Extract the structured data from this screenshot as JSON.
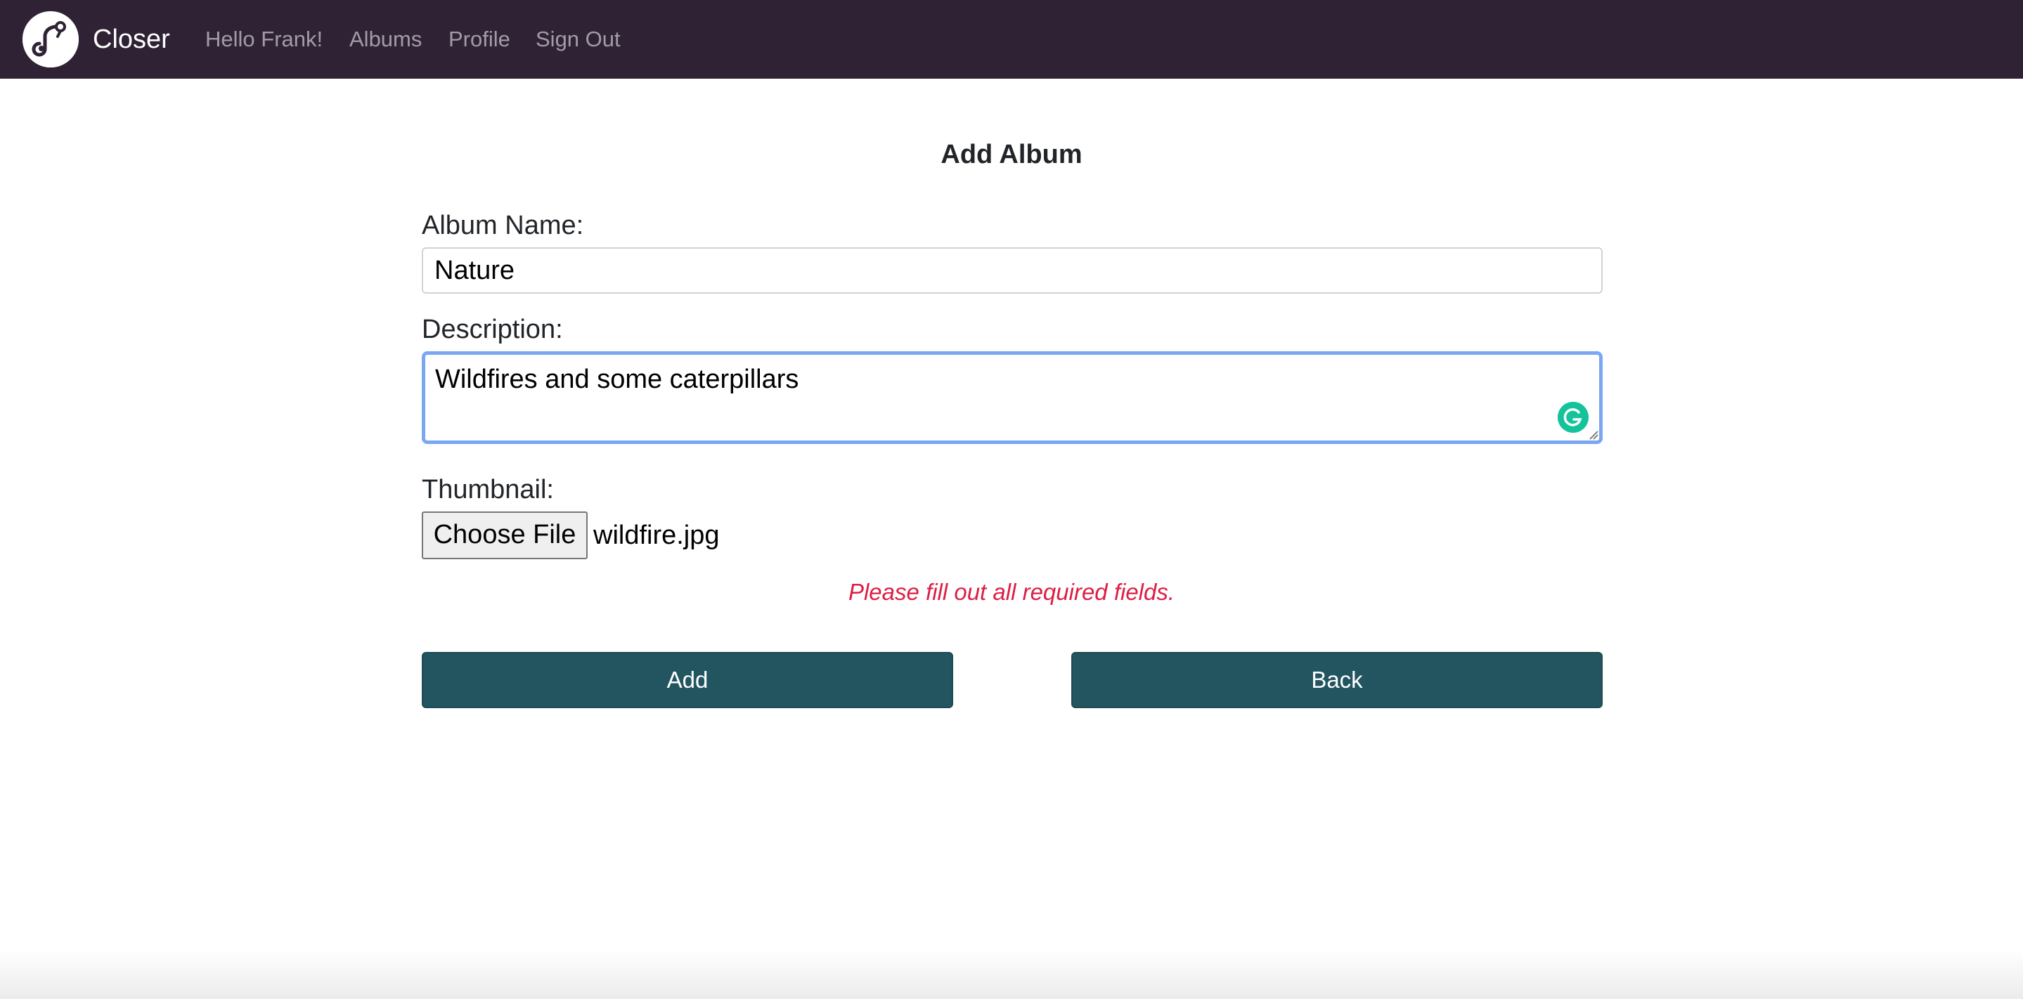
{
  "navbar": {
    "brand": "Closer",
    "links": {
      "greeting": "Hello Frank!",
      "albums": "Albums",
      "profile": "Profile",
      "sign_out": "Sign Out"
    }
  },
  "form": {
    "title": "Add Album",
    "album_name_label": "Album Name:",
    "album_name_value": "Nature",
    "description_label": "Description:",
    "description_value": "Wildfires and some caterpillars",
    "thumbnail_label": "Thumbnail:",
    "choose_file_label": "Choose File",
    "file_name": "wildfire.jpg",
    "error_message": "Please fill out all required fields.",
    "add_label": "Add",
    "back_label": "Back"
  },
  "colors": {
    "navbar_bg": "#2f2235",
    "button_bg": "#225560",
    "error": "#dc1e45",
    "focus_border": "#7aa7f2",
    "grammarly": "#15c39a"
  },
  "icons": {
    "logo": "closer-logo-icon",
    "grammarly": "grammarly-icon",
    "resize": "resize-handle-icon"
  }
}
